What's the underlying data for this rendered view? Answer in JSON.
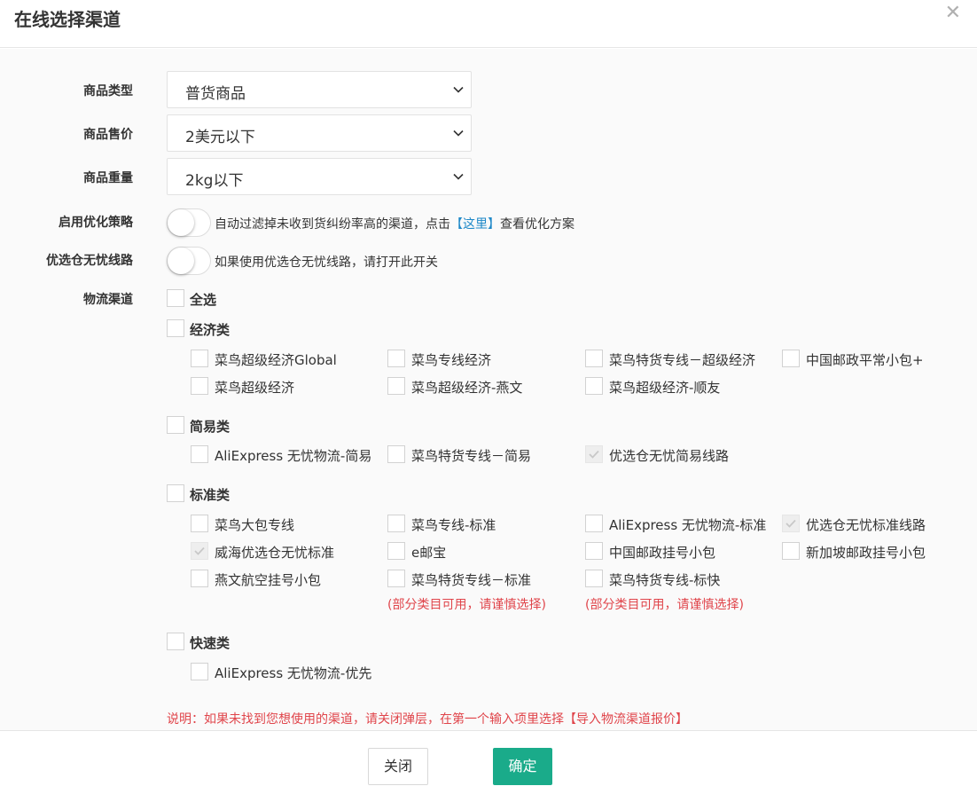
{
  "dialog": {
    "title": "在线选择渠道",
    "close_icon": "close-icon"
  },
  "form": {
    "product_type": {
      "label": "商品类型",
      "value": "普货商品"
    },
    "product_price": {
      "label": "商品售价",
      "value": "2美元以下"
    },
    "product_weight": {
      "label": "商品重量",
      "value": "2kg以下"
    },
    "optimize": {
      "label": "启用优化策略",
      "text_before": "自动过滤掉未收到货纠纷率高的渠道，点击",
      "link_text": "【这里】",
      "text_after": "查看优化方案",
      "on": false
    },
    "preferred": {
      "label": "优选仓无忧线路",
      "text": "如果使用优选仓无忧线路，请打开此开关",
      "on": false
    },
    "channels_label": "物流渠道"
  },
  "channels": {
    "select_all": "全选",
    "groups": [
      {
        "name": "经济类",
        "options": [
          {
            "label": "菜鸟超级经济Global",
            "checked": false
          },
          {
            "label": "菜鸟专线经济",
            "checked": false
          },
          {
            "label": "菜鸟特货专线－超级经济",
            "checked": false
          },
          {
            "label": "中国邮政平常小包+",
            "checked": false
          },
          {
            "label": "菜鸟超级经济",
            "checked": false
          },
          {
            "label": "菜鸟超级经济-燕文",
            "checked": false
          },
          {
            "label": "菜鸟超级经济-顺友",
            "checked": false
          }
        ]
      },
      {
        "name": "简易类",
        "options": [
          {
            "label": "AliExpress 无忧物流-简易",
            "checked": false
          },
          {
            "label": "菜鸟特货专线－简易",
            "checked": false
          },
          {
            "label": "优选仓无忧简易线路",
            "checked": true
          }
        ]
      },
      {
        "name": "标准类",
        "options": [
          {
            "label": "菜鸟大包专线",
            "checked": false
          },
          {
            "label": "菜鸟专线-标准",
            "checked": false
          },
          {
            "label": "AliExpress 无忧物流-标准",
            "checked": false
          },
          {
            "label": "优选仓无忧标准线路",
            "checked": true
          },
          {
            "label": "威海优选仓无忧标准",
            "checked": true
          },
          {
            "label": "e邮宝",
            "checked": false
          },
          {
            "label": "中国邮政挂号小包",
            "checked": false
          },
          {
            "label": "新加坡邮政挂号小包",
            "checked": false
          },
          {
            "label": "燕文航空挂号小包",
            "checked": false
          },
          {
            "label": "菜鸟特货专线－标准",
            "checked": false
          },
          {
            "label": "菜鸟特货专线-标快",
            "checked": false
          }
        ],
        "warnings": [
          "(部分类目可用，请谨慎选择)",
          "(部分类目可用，请谨慎选择)"
        ]
      },
      {
        "name": "快速类",
        "options": [
          {
            "label": "AliExpress 无忧物流-优先",
            "checked": false
          }
        ]
      }
    ]
  },
  "note": "说明：如果未找到您想使用的渠道，请关闭弹层，在第一个输入项里选择【导入物流渠道报价】",
  "buttons": {
    "close": "关闭",
    "confirm": "确定"
  },
  "colors": {
    "accent": "#1aab8a",
    "link": "#1e88c8",
    "warning": "#e0454b"
  }
}
